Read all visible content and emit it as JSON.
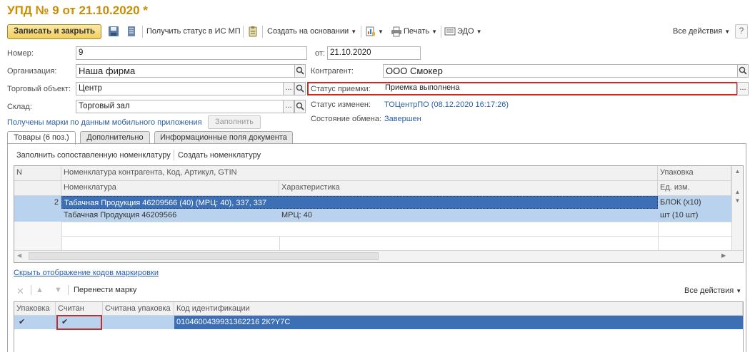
{
  "window": {
    "title": "УПД № 9 от 21.10.2020 *"
  },
  "toolbar": {
    "save_close": "Записать и закрыть",
    "get_status": "Получить статус в ИС МП",
    "create_based": "Создать на основании",
    "print": "Печать",
    "edo": "ЭДО",
    "all_actions": "Все действия"
  },
  "form": {
    "number_label": "Номер:",
    "number_value": "9",
    "date_label": "от:",
    "date_value": "21.10.2020",
    "org_label": "Организация:",
    "org_value": "Наша фирма",
    "counterparty_label": "Контрагент:",
    "counterparty_value": "ООО Смокер",
    "trade_obj_label": "Торговый объект:",
    "trade_obj_value": "Центр",
    "accept_status_label": "Статус приемки:",
    "accept_status_value": "Приемка выполнена",
    "warehouse_label": "Склад:",
    "warehouse_value": "Торговый зал",
    "status_changed_label": "Статус изменен:",
    "status_changed_value": "ТОЦентрПО (08.12.2020 16:17:26)",
    "exchange_label": "Состояние обмена:",
    "exchange_value": "Завершен",
    "marks_link": "Получены марки по данным мобильного приложения",
    "fill_button": "Заполнить"
  },
  "tabs": [
    {
      "label": "Товары (6 поз.)"
    },
    {
      "label": "Дополнительно"
    },
    {
      "label": "Информационные поля документа"
    }
  ],
  "goods": {
    "fill_mapped": "Заполнить сопоставленную номенклатуру",
    "create_item": "Создать номенклатуру",
    "headers": {
      "n": "N",
      "contractor_item": "Номенклатура контрагента, Код, Артикул, GTIN",
      "packaging": "Упаковка",
      "item": "Номенклатура",
      "characteristic": "Характеристика",
      "unit": "Ед. изм."
    },
    "row": {
      "n": "2",
      "contractor_item": "Табачная Продукция 46209566 (40) (МРЦ: 40), 337, 337",
      "packaging": "БЛОК (х10)",
      "item": "Табачная Продукция 46209566",
      "characteristic": "МРЦ: 40",
      "unit": "шт (10 шт)"
    }
  },
  "marks": {
    "hide_link": "Скрыть отображение кодов маркировки",
    "move_mark": "Перенести марку",
    "all_actions": "Все действия",
    "headers": {
      "packaging": "Упаковка",
      "scanned": "Считан",
      "scanned_pack": "Считана упаковка",
      "code": "Код идентификации"
    },
    "row": {
      "code": "0104600439931362216 2К?Y7С"
    }
  },
  "colors": {
    "title": "#cc8d00",
    "selection": "#b9d3ee",
    "selection_dark": "#3c6fb4",
    "highlight_box": "#c0302a",
    "link": "#2c5fa8"
  }
}
